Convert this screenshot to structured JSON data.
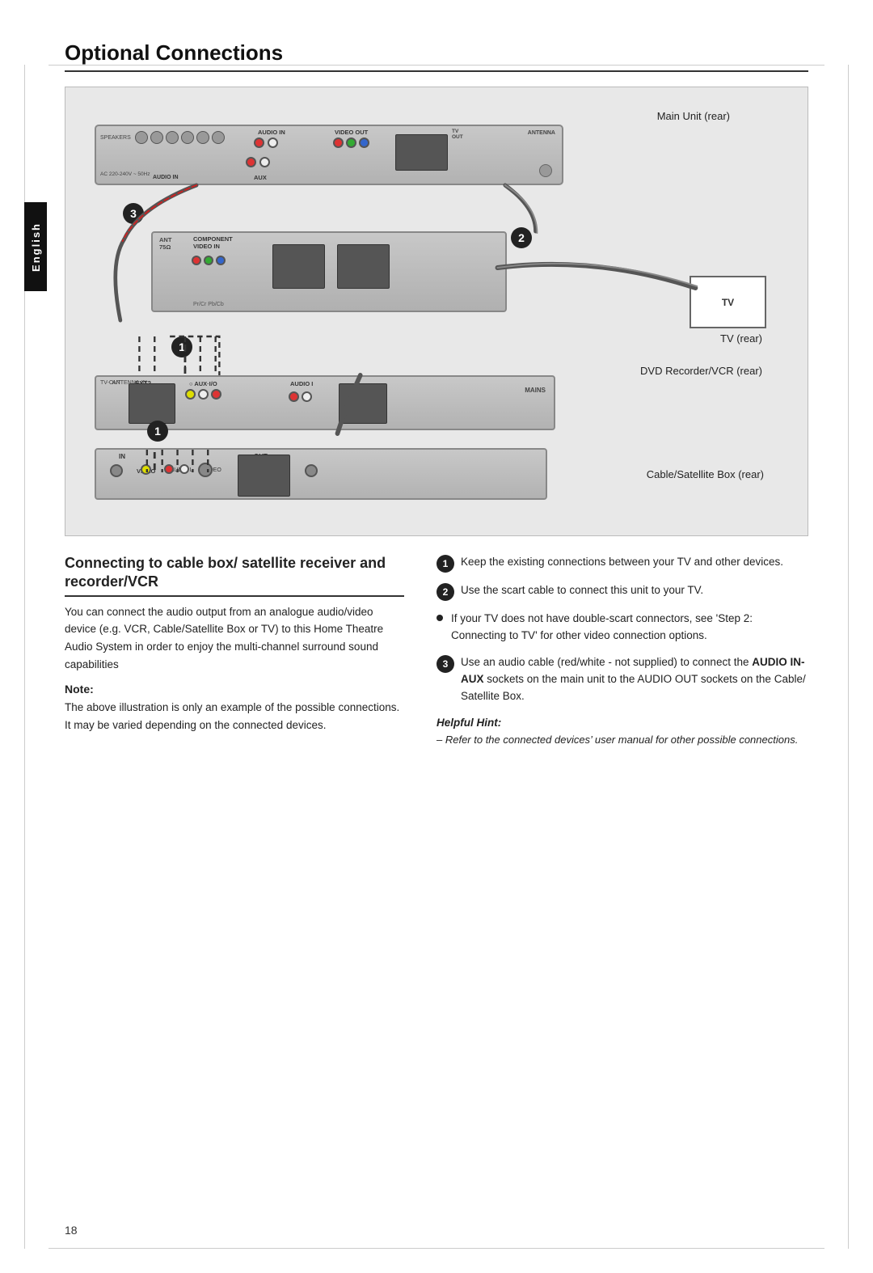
{
  "page": {
    "title": "Optional Connections",
    "page_number": "18",
    "language_tab": "English"
  },
  "diagram": {
    "label_main_unit": "Main Unit (rear)",
    "label_tv_rear": "TV (rear)",
    "label_tv": "TV",
    "label_dvd_rear": "DVD Recorder/VCR (rear)",
    "label_cable_box": "Cable/Satellite Box\n(rear)",
    "step_numbers": [
      "1",
      "2",
      "3"
    ]
  },
  "section": {
    "heading": "Connecting to cable box/ satellite receiver and recorder/VCR",
    "body": "You can connect the audio output from an analogue audio/video device (e.g. VCR, Cable/Satellite Box or TV) to this Home Theatre Audio System in order to enjoy the multi-channel surround sound capabilities",
    "note_label": "Note:",
    "note_text": "The above illustration is only an example of the possible connections. It may be varied depending on the connected devices."
  },
  "steps": [
    {
      "number": "1",
      "type": "circle",
      "text": "Keep the existing connections between your TV and other devices."
    },
    {
      "number": "2",
      "type": "circle",
      "text": "Use the scart cable to connect this unit to your TV."
    },
    {
      "number": "bullet",
      "type": "bullet",
      "text": "If your TV does not have double-scart connectors, see ‘Step 2: Connecting to TV’ for other video connection options."
    },
    {
      "number": "3",
      "type": "circle",
      "text": "Use an audio cable (red/white - not supplied) to connect the AUDIO IN-AUX sockets on the main unit to the AUDIO OUT sockets on the Cable/ Satellite Box."
    }
  ],
  "helpful_hint": {
    "label": "Helpful Hint:",
    "text": "– Refer to the connected devices’ user manual for other possible connections."
  }
}
